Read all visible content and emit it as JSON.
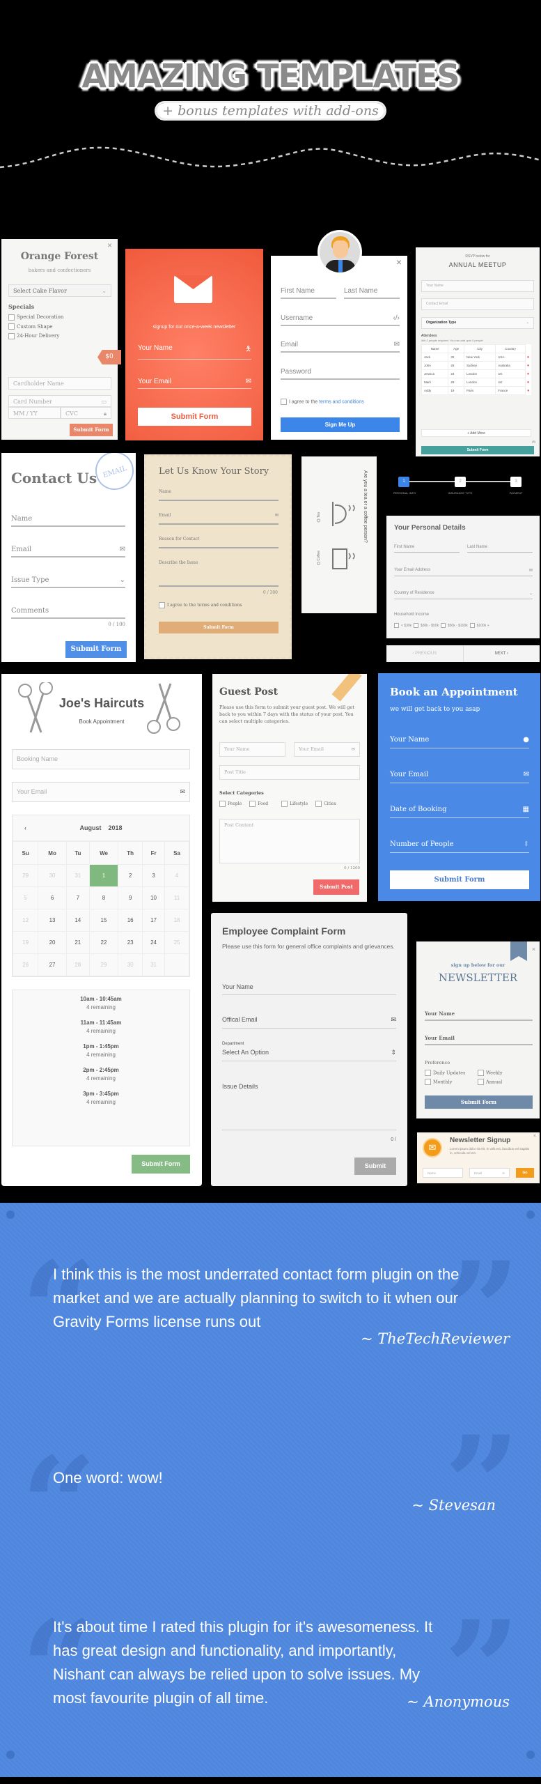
{
  "header": {
    "title": "AMAZING TEMPLATES",
    "subtitle": "+ bonus templates with add-ons"
  },
  "orange_forest": {
    "title": "Orange Forest",
    "subtitle": "bakers and confectioners",
    "select_placeholder": "Select Cake Flavor",
    "specials_label": "Specials",
    "specials": [
      "Special Decoration",
      "Custom Shape",
      "24-Hour Delivery"
    ],
    "price": "$0",
    "cardholder_placeholder": "Cardholder Name",
    "card_number_placeholder": "Card Number",
    "expiry_placeholder": "MM / YY",
    "cvc_placeholder": "CVC",
    "submit": "Submit Form",
    "close": "×"
  },
  "orange_newsletter": {
    "tagline": "signup for our once-a-week newsletter",
    "name_placeholder": "Your Name",
    "email_placeholder": "Your Email",
    "submit": "Submit Form"
  },
  "signup": {
    "close": "×",
    "first_name": "First Name",
    "last_name": "Last Name",
    "username": "Username",
    "email": "Email",
    "password": "Password",
    "agree_prefix": "I agree to the ",
    "agree_link": "terms and conditions",
    "submit": "Sign Me Up"
  },
  "rsvp": {
    "pre_title": "RSVP below for",
    "title": "ANNUAL MEETUP",
    "name_placeholder": "Your Name",
    "email_placeholder": "Contact Email",
    "org_select": "Organization Type",
    "attendees_label": "Attendees",
    "attendees_note": "Min 2 people required. You can add upto 5 people.",
    "columns": [
      "Name",
      "Age",
      "City",
      "Country"
    ],
    "rows": [
      [
        "Jack",
        "32",
        "New York",
        "USA"
      ],
      [
        "John",
        "28",
        "Sydney",
        "Australia"
      ],
      [
        "Jessica",
        "23",
        "London",
        "UK"
      ],
      [
        "Mark",
        "29",
        "London",
        "UK"
      ],
      [
        "Addy",
        "19",
        "Paris",
        "France"
      ]
    ],
    "add_more": "+ Add More",
    "count": "(5)",
    "submit": "Submit Form"
  },
  "contact": {
    "title": "Contact Us",
    "stamp": "EMAIL",
    "name": "Name",
    "email": "Email",
    "issue": "Issue Type",
    "comments": "Comments",
    "counter": "0 / 100",
    "submit": "Submit Form"
  },
  "story": {
    "title": "Let Us Know Your Story",
    "name": "Name",
    "email": "Email",
    "reason": "Reason for Contact",
    "describe": "Describe the Issue",
    "counter": "0 / 300",
    "agree": "I agree to the terms and conditions",
    "submit": "Submit Form"
  },
  "tea": {
    "question": "Are you a tea or a coffee person?",
    "options": [
      "Tea",
      "Coffee"
    ]
  },
  "steps": {
    "items": [
      {
        "num": "1",
        "label": "PERSONAL INFO"
      },
      {
        "num": "2",
        "label": "INSURANCE TYPE"
      },
      {
        "num": "3",
        "label": "PAYMENT"
      }
    ],
    "current_step": 1
  },
  "personal": {
    "title": "Your Personal Details",
    "first_name": "First Name",
    "last_name": "Last Name",
    "email": "Your Email Address",
    "country": "Country of Residence",
    "income_label": "Household Income",
    "income_options": [
      "< $30k",
      "$30k - $50k",
      "$50k - $100k",
      "$100k +"
    ],
    "prev": "‹ PREVIOUS",
    "next": "NEXT ›"
  },
  "haircuts": {
    "title": "Joe's Haircuts",
    "subtitle": "Book Appointment",
    "name_placeholder": "Booking Name",
    "email_placeholder": "Your Email",
    "month": "August",
    "year": "2018",
    "weekdays": [
      "Su",
      "Mo",
      "Tu",
      "We",
      "Th",
      "Fr",
      "Sa"
    ],
    "weeks": [
      [
        "29",
        "30",
        "31",
        "1",
        "2",
        "3",
        "4"
      ],
      [
        "5",
        "6",
        "7",
        "8",
        "9",
        "10",
        "11"
      ],
      [
        "12",
        "13",
        "14",
        "15",
        "16",
        "17",
        "18"
      ],
      [
        "19",
        "20",
        "21",
        "22",
        "23",
        "24",
        "25"
      ],
      [
        "26",
        "27",
        "28",
        "29",
        "30",
        "31",
        ""
      ]
    ],
    "selected_day": "1",
    "slots": [
      {
        "time": "10am - 10:45am",
        "remaining": "4 remaining"
      },
      {
        "time": "11am - 11:45am",
        "remaining": "4 remaining"
      },
      {
        "time": "1pm - 1:45pm",
        "remaining": "4 remaining"
      },
      {
        "time": "2pm - 2:45pm",
        "remaining": "4 remaining"
      },
      {
        "time": "3pm - 3:45pm",
        "remaining": "4 remaining"
      }
    ],
    "submit": "Submit Form"
  },
  "guest_post": {
    "title": "Guest Post",
    "description": "Please use this form to submit your guest post. We will get back to you within 7 days with the status of your post. You can select multiple categories.",
    "name_placeholder": "Your Name",
    "email_placeholder": "Your Email",
    "post_title_placeholder": "Post Title",
    "categories_label": "Select Categories",
    "categories": [
      "People",
      "Food",
      "Lifestyle",
      "Cities"
    ],
    "content_placeholder": "Post Content",
    "counter": "0 / 1200",
    "submit": "Submit Post"
  },
  "appointment": {
    "title": "Book an Appointment",
    "subtitle": "we will get back to you asap",
    "name": "Your Name",
    "email": "Your Email",
    "date": "Date of Booking",
    "people": "Number of People",
    "submit": "Submit Form"
  },
  "complaint": {
    "title": "Employee Complaint Form",
    "description": "Please use this form for general office complaints and grievances.",
    "name": "Your Name",
    "email": "Offical Email",
    "dept_label": "Department",
    "dept_select": "Select An Option",
    "issue": "Issue Details",
    "counter": "0 /",
    "submit": "Submit"
  },
  "newsletter": {
    "pre_title": "sign up below for our",
    "title": "NEWSLETTER",
    "name": "Your Name",
    "email": "Your Email",
    "pref_label": "Preference",
    "prefs": [
      "Daily Updates",
      "Weekly",
      "Monthly",
      "Annual"
    ],
    "submit": "Submit Form",
    "close": "×"
  },
  "mini_signup": {
    "title": "Newsletter Signup",
    "text": "Lorem ipsum dolor sit elit. In velit est, faucibus vel sagittis in, vehicula vel est.",
    "name_placeholder": "Name",
    "email_placeholder": "Email",
    "go": "Go",
    "close": "×"
  },
  "testimonials": [
    {
      "quote": "I think this is the most underrated contact form plugin on the market and we are actually planning to switch to it when our Gravity Forms license runs out",
      "author": "~ TheTechReviewer"
    },
    {
      "quote": "One word: wow!",
      "author": "~ Stevesan"
    },
    {
      "quote": "It's about time I rated this plugin for it's awesomeness. It has great design and functionality, and importantly, Nishant can always be relied upon to solve issues. My most favourite plugin of all time.",
      "author": "~ Anonymous"
    }
  ],
  "colors": {
    "orange": "#f26445",
    "blue": "#4a8ae6",
    "quote_bg": "#4f87de",
    "teal": "#46a09c",
    "green": "#7fb97f",
    "salmon": "#f06a6a"
  }
}
